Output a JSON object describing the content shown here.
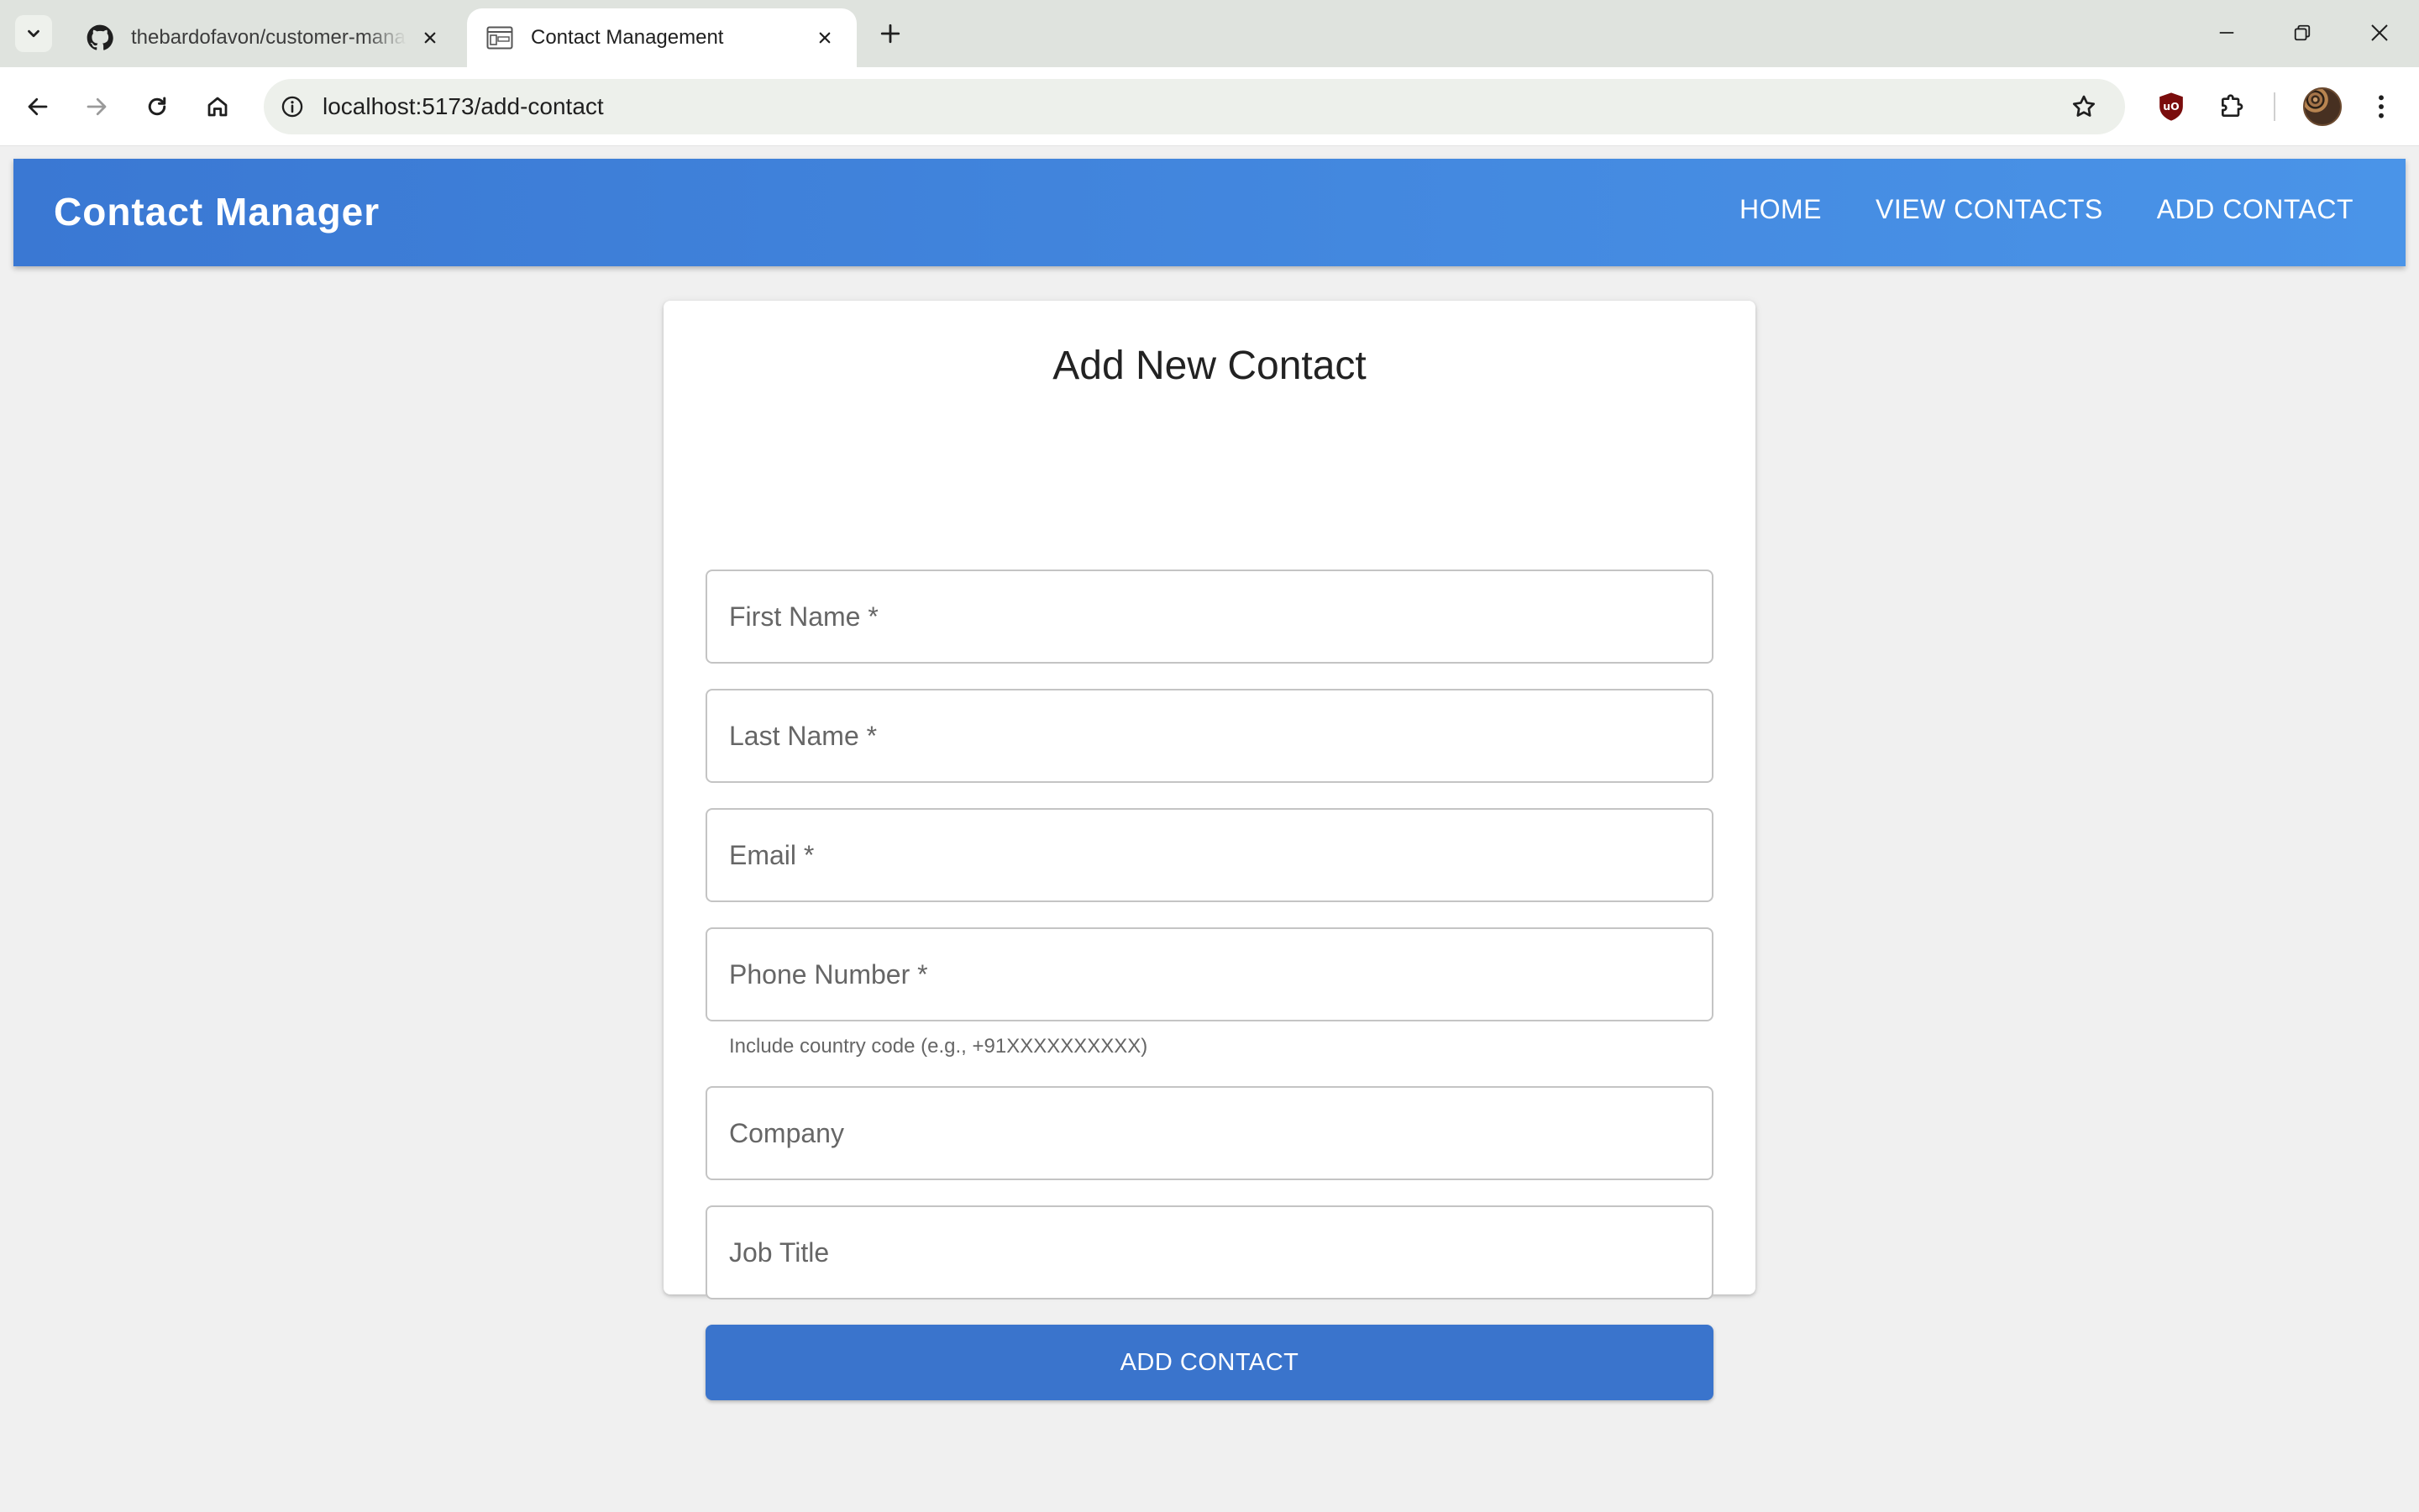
{
  "browser": {
    "tabs": [
      {
        "title": "thebardofavon/customer-management",
        "icon": "github-icon",
        "active": false
      },
      {
        "title": "Contact Management",
        "icon": "crm-favicon-icon",
        "active": true
      }
    ],
    "url": "localhost:5173/add-contact"
  },
  "app": {
    "brand": "Contact Manager",
    "nav": [
      {
        "label": "HOME"
      },
      {
        "label": "VIEW CONTACTS"
      },
      {
        "label": "ADD CONTACT"
      }
    ]
  },
  "form": {
    "title": "Add New Contact",
    "fields": [
      {
        "label": "First Name *",
        "value": ""
      },
      {
        "label": "Last Name *",
        "value": ""
      },
      {
        "label": "Email *",
        "value": ""
      },
      {
        "label": "Phone Number *",
        "value": "",
        "helper": "Include country code (e.g., +91XXXXXXXXXX)"
      },
      {
        "label": "Company",
        "value": ""
      },
      {
        "label": "Job Title",
        "value": ""
      }
    ],
    "submit_label": "ADD CONTACT"
  },
  "colors": {
    "appbar_start": "#3a78d3",
    "appbar_end": "#4a94e8",
    "primary_button": "#3a74cc",
    "page_background": "#f0f0f0"
  }
}
